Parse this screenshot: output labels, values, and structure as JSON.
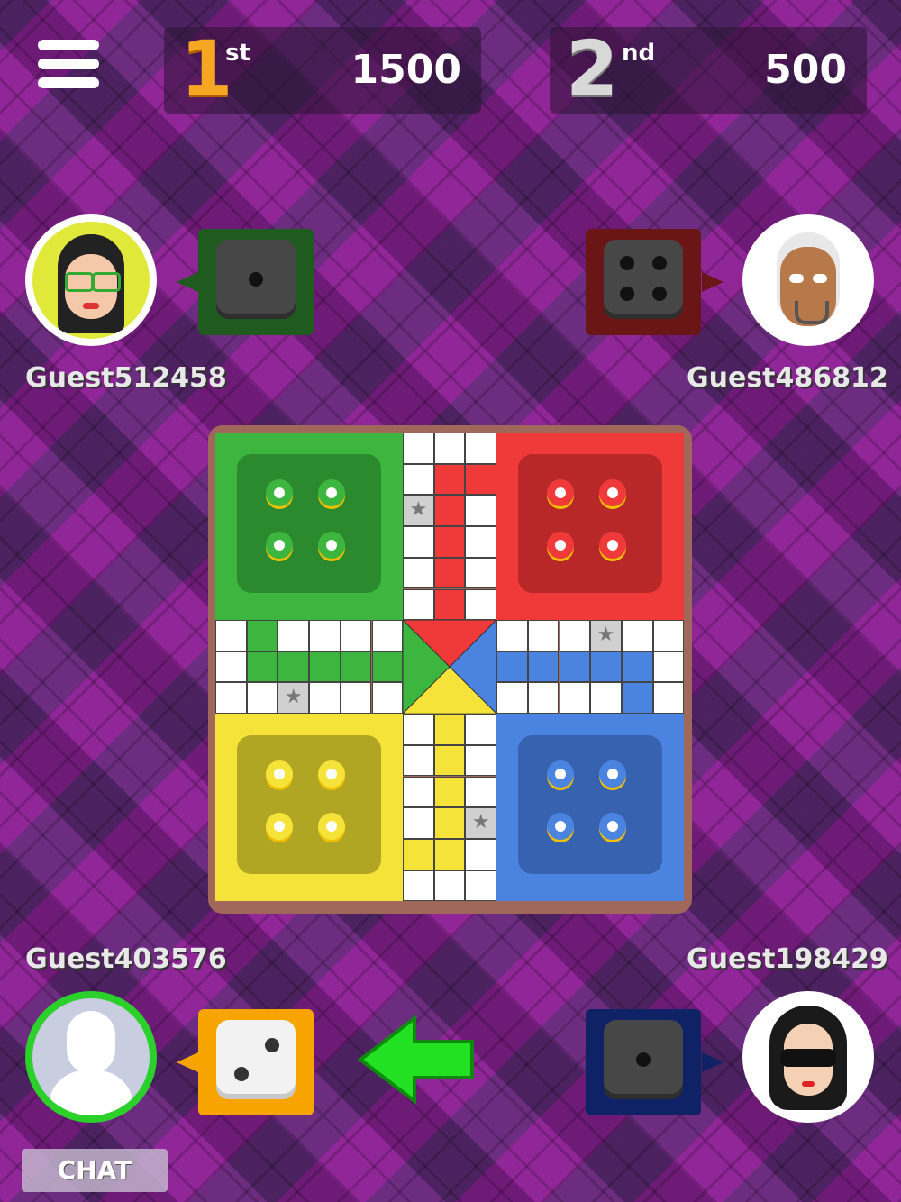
{
  "menu": {
    "icon": "hamburger-menu-icon"
  },
  "scores": [
    {
      "rank": "1",
      "suffix": "st",
      "value": "1500"
    },
    {
      "rank": "2",
      "suffix": "nd",
      "value": "500"
    }
  ],
  "players": [
    {
      "name": "Guest512458",
      "color": "green",
      "die_value": 1
    },
    {
      "name": "Guest486812",
      "color": "red",
      "die_value": 4
    },
    {
      "name": "Guest403576",
      "color": "yellow",
      "die_value": 2,
      "active_turn": true
    },
    {
      "name": "Guest198429",
      "color": "blue",
      "die_value": 1
    }
  ],
  "colors": {
    "green": "#3cb63f",
    "green_dark": "#2b8a2e",
    "red": "#f03a3a",
    "red_dark": "#b82828",
    "yellow": "#f6e33a",
    "yellow_dark": "#b0a624",
    "blue": "#4a84e0",
    "blue_dark": "#3762b0",
    "turn_arrow": "#22e022"
  },
  "chat": {
    "label": "CHAT"
  }
}
